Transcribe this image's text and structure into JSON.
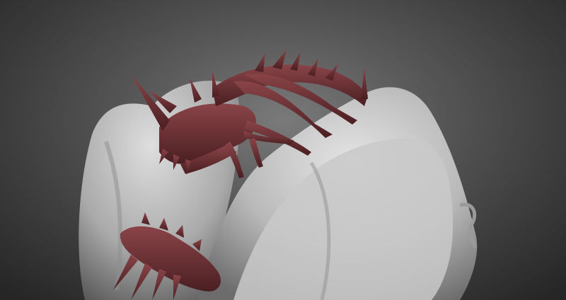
{
  "scene": {
    "background_color": "#4a4a4a",
    "clay_color": "#c8c8c8",
    "sculpt_color": "#6b2f32",
    "objects": [
      "grey-clay-mass",
      "red-spiked-creature-head",
      "red-spiked-tail-segment"
    ]
  }
}
